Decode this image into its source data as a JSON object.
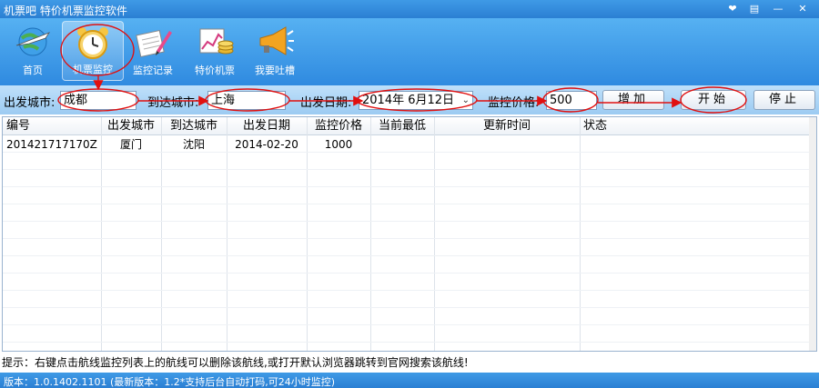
{
  "window": {
    "title": "机票吧  特价机票监控软件"
  },
  "toolbar": {
    "items": [
      {
        "label": "首页",
        "icon": "globe-plane-icon"
      },
      {
        "label": "机票监控",
        "icon": "alarm-clock-icon",
        "active": true
      },
      {
        "label": "监控记录",
        "icon": "notepad-pencil-icon"
      },
      {
        "label": "特价机票",
        "icon": "chart-coins-icon"
      },
      {
        "label": "我要吐槽",
        "icon": "megaphone-icon"
      }
    ]
  },
  "query": {
    "depart_city_label": "出发城市:",
    "depart_city_value": "成都",
    "arrive_city_label": "到达城市:",
    "arrive_city_value": "上海",
    "depart_date_label": "出发日期:",
    "depart_date_value": "2014年 6月12日",
    "price_label": "监控价格:",
    "price_value": "500",
    "add_button": "增加",
    "start_button": "开始",
    "stop_button": "停止"
  },
  "table": {
    "columns": [
      "编号",
      "出发城市",
      "到达城市",
      "出发日期",
      "监控价格",
      "当前最低",
      "更新时间",
      "状态"
    ],
    "rows": [
      [
        "201421717170Z",
        "厦门",
        "沈阳",
        "2014-02-20",
        "1000",
        "",
        "",
        ""
      ]
    ]
  },
  "hint": "提示：右键点击航线监控列表上的航线可以删除该航线,或打开默认浏览器跳转到官网搜索该航线!",
  "status": "版本：1.0.1402.1101  (最新版本：1.2*支持后台自动打码,可24小时监控)",
  "colors": {
    "accent": "#2b7fd3",
    "annotation_red": "#e01010"
  }
}
